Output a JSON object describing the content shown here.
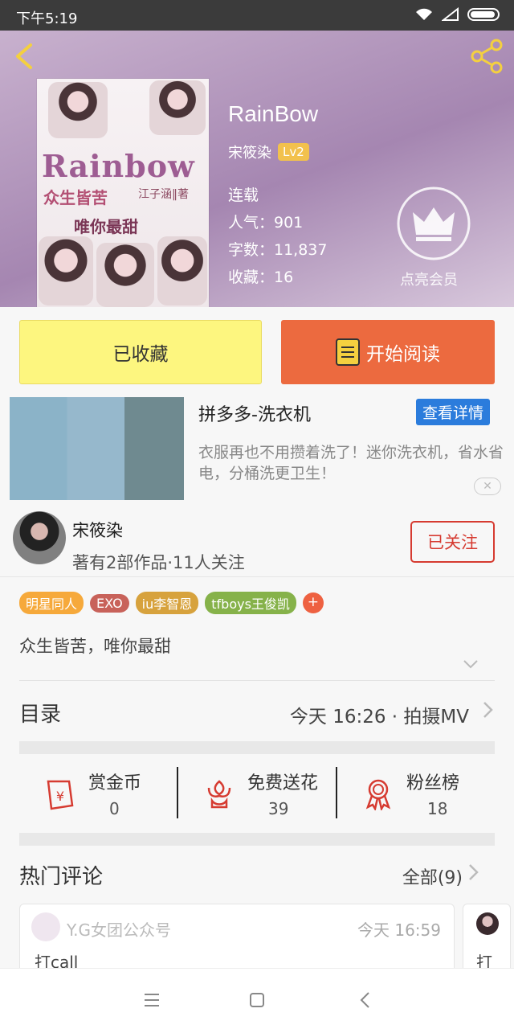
{
  "status": {
    "time": "下午5:19"
  },
  "cover": {
    "title": "Rainbow",
    "subtitle": "众生皆苦",
    "author": "江子涵‖著",
    "subtitle2": "唯你最甜"
  },
  "book": {
    "title": "RainBow",
    "author": "宋筱染",
    "level": "Lv2",
    "status": "连载",
    "popularity": "人气：901",
    "word_count": "字数：11,837",
    "favorites": "收藏：16",
    "vip_label": "点亮会员"
  },
  "actions": {
    "collected": "已收藏",
    "start_reading": "开始阅读"
  },
  "ad": {
    "title": "拼多多-洗衣机",
    "detail_button": "查看详情",
    "description": "衣服再也不用攒着洗了！迷你洗衣机，省水省电，分桶洗更卫生！",
    "close": "✕"
  },
  "author_card": {
    "name": "宋筱染",
    "summary": "著有2部作品·11人关注",
    "follow_button": "已关注"
  },
  "tags": [
    {
      "label": "明星同人",
      "color": "#f6a93b"
    },
    {
      "label": "EXO",
      "color": "#c8625a"
    },
    {
      "label": "iu李智恩",
      "color": "#d7a23d"
    },
    {
      "label": "tfboys王俊凯",
      "color": "#86b24a"
    }
  ],
  "tag_add": "+",
  "intro": "众生皆苦，唯你最甜",
  "toc": {
    "title": "目录",
    "latest": "今天 16:26 · 拍摄MV"
  },
  "stats": [
    {
      "label": "赏金币",
      "value": "0",
      "icon": "red-envelope-icon"
    },
    {
      "label": "免费送花",
      "value": "39",
      "icon": "flower-icon"
    },
    {
      "label": "粉丝榜",
      "value": "18",
      "icon": "medal-icon"
    }
  ],
  "comments": {
    "title": "热门评论",
    "all": "全部(9)",
    "items": [
      {
        "user": "Y.G女团公众号",
        "time": "今天 16:59",
        "text": "打call"
      },
      {
        "user": "",
        "time": "",
        "text": "打"
      }
    ]
  },
  "colors": {
    "accent_orange": "#ec6a3f",
    "accent_red": "#d63b31",
    "ad_blue": "#2b7cdc",
    "collect_yellow": "#fdf67f"
  }
}
